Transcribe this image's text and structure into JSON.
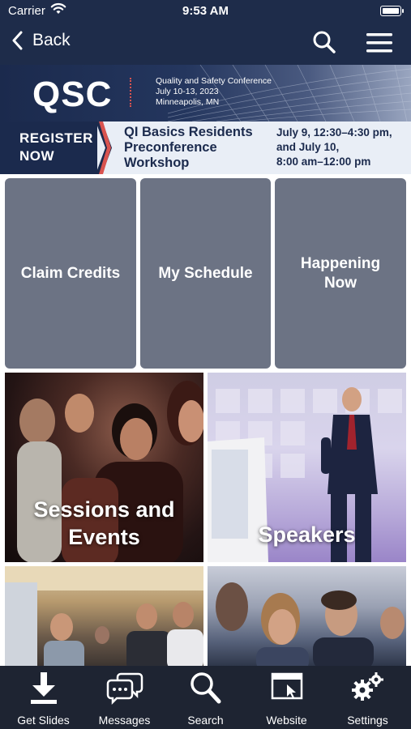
{
  "status_bar": {
    "carrier": "Carrier",
    "time": "9:53 AM"
  },
  "nav": {
    "back_label": "Back"
  },
  "banner": {
    "logo": "QSC",
    "conference_name": "Quality and Safety Conference",
    "conference_dates": "July 10-13, 2023",
    "conference_location": "Minneapolis, MN",
    "register_line1": "REGISTER",
    "register_line2": "NOW",
    "workshop_line1": "QI Basics Residents",
    "workshop_line2": "Preconference",
    "workshop_line3": "Workshop",
    "dates_line1": "July 9, 12:30–4:30 pm,",
    "dates_line2": "and July 10,",
    "dates_line3": "8:00 am–12:00 pm"
  },
  "tiles": [
    {
      "label": "Claim Credits"
    },
    {
      "label": "My Schedule"
    },
    {
      "label": "Happening Now"
    }
  ],
  "photo_tiles": [
    {
      "label_line1": "Sessions and",
      "label_line2": "Events"
    },
    {
      "label": "Speakers"
    }
  ],
  "tabbar": {
    "items": [
      {
        "label": "Get Slides",
        "icon": "download-icon"
      },
      {
        "label": "Messages",
        "icon": "chat-bubbles-icon"
      },
      {
        "label": "Search",
        "icon": "search-icon"
      },
      {
        "label": "Website",
        "icon": "browser-window-icon"
      },
      {
        "label": "Settings",
        "icon": "gears-icon"
      }
    ]
  },
  "colors": {
    "nav_bg": "#1e2c4a",
    "tile_bg": "#6c7384",
    "tabbar_bg": "#1e2432",
    "accent_red": "#d9534f"
  }
}
